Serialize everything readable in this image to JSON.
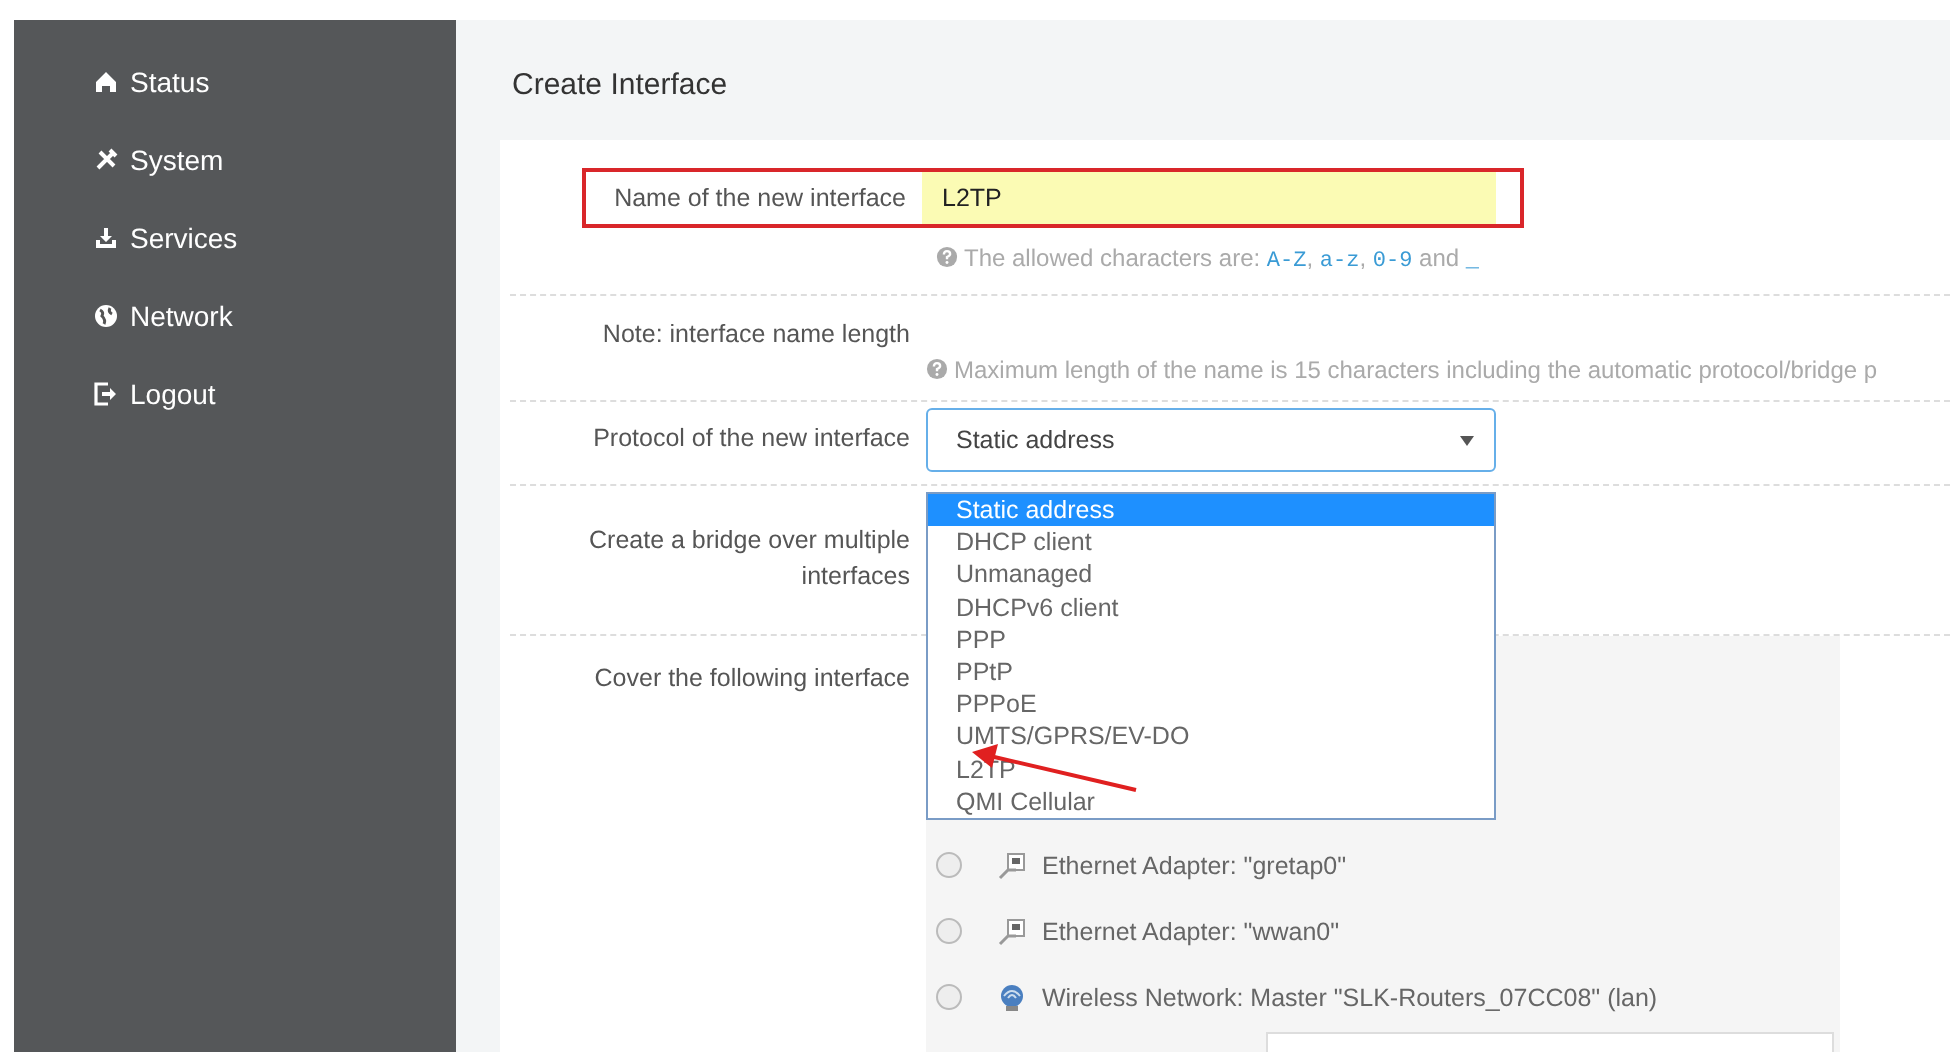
{
  "sidebar": {
    "items": [
      {
        "label": "Status"
      },
      {
        "label": "System"
      },
      {
        "label": "Services"
      },
      {
        "label": "Network"
      },
      {
        "label": "Logout"
      }
    ]
  },
  "page_title": "Create Interface",
  "name_field": {
    "label": "Name of the new interface",
    "value": "L2TP",
    "hint": [
      {
        "kind": "text",
        "text": "The allowed characters are: "
      },
      {
        "kind": "code",
        "text": "A-Z"
      },
      {
        "kind": "text",
        "text": ", "
      },
      {
        "kind": "code",
        "text": "a-z"
      },
      {
        "kind": "text",
        "text": ", "
      },
      {
        "kind": "code",
        "text": "0-9"
      },
      {
        "kind": "text",
        "text": " and "
      },
      {
        "kind": "code",
        "text": "_"
      }
    ]
  },
  "note": {
    "label": "Note: interface name length",
    "hint": "Maximum length of the name is 15 characters including the automatic protocol/bridge p"
  },
  "protocol": {
    "label": "Protocol of the new interface",
    "value": "Static address",
    "options": [
      {
        "label": "Static address",
        "selected": true
      },
      {
        "label": "DHCP client",
        "selected": false
      },
      {
        "label": "Unmanaged",
        "selected": false
      },
      {
        "label": "DHCPv6 client",
        "selected": false
      },
      {
        "label": "PPP",
        "selected": false
      },
      {
        "label": "PPtP",
        "selected": false
      },
      {
        "label": "PPPoE",
        "selected": false
      },
      {
        "label": "UMTS/GPRS/EV-DO",
        "selected": false
      },
      {
        "label": "L2TP",
        "selected": false
      },
      {
        "label": "QMI Cellular",
        "selected": false
      }
    ]
  },
  "bridge": {
    "label": "Create a bridge over multiple interfaces"
  },
  "cover": {
    "label": "Cover the following interface",
    "interfaces": [
      {
        "kind": "ethernet",
        "label": "Ethernet Adapter: \"gretap0\"",
        "selected": false
      },
      {
        "kind": "ethernet",
        "label": "Ethernet Adapter: \"wwan0\"",
        "selected": false
      },
      {
        "kind": "wireless",
        "label": "Wireless Network: Master \"SLK-Routers_07CC08\" (lan)",
        "selected": false
      }
    ]
  }
}
